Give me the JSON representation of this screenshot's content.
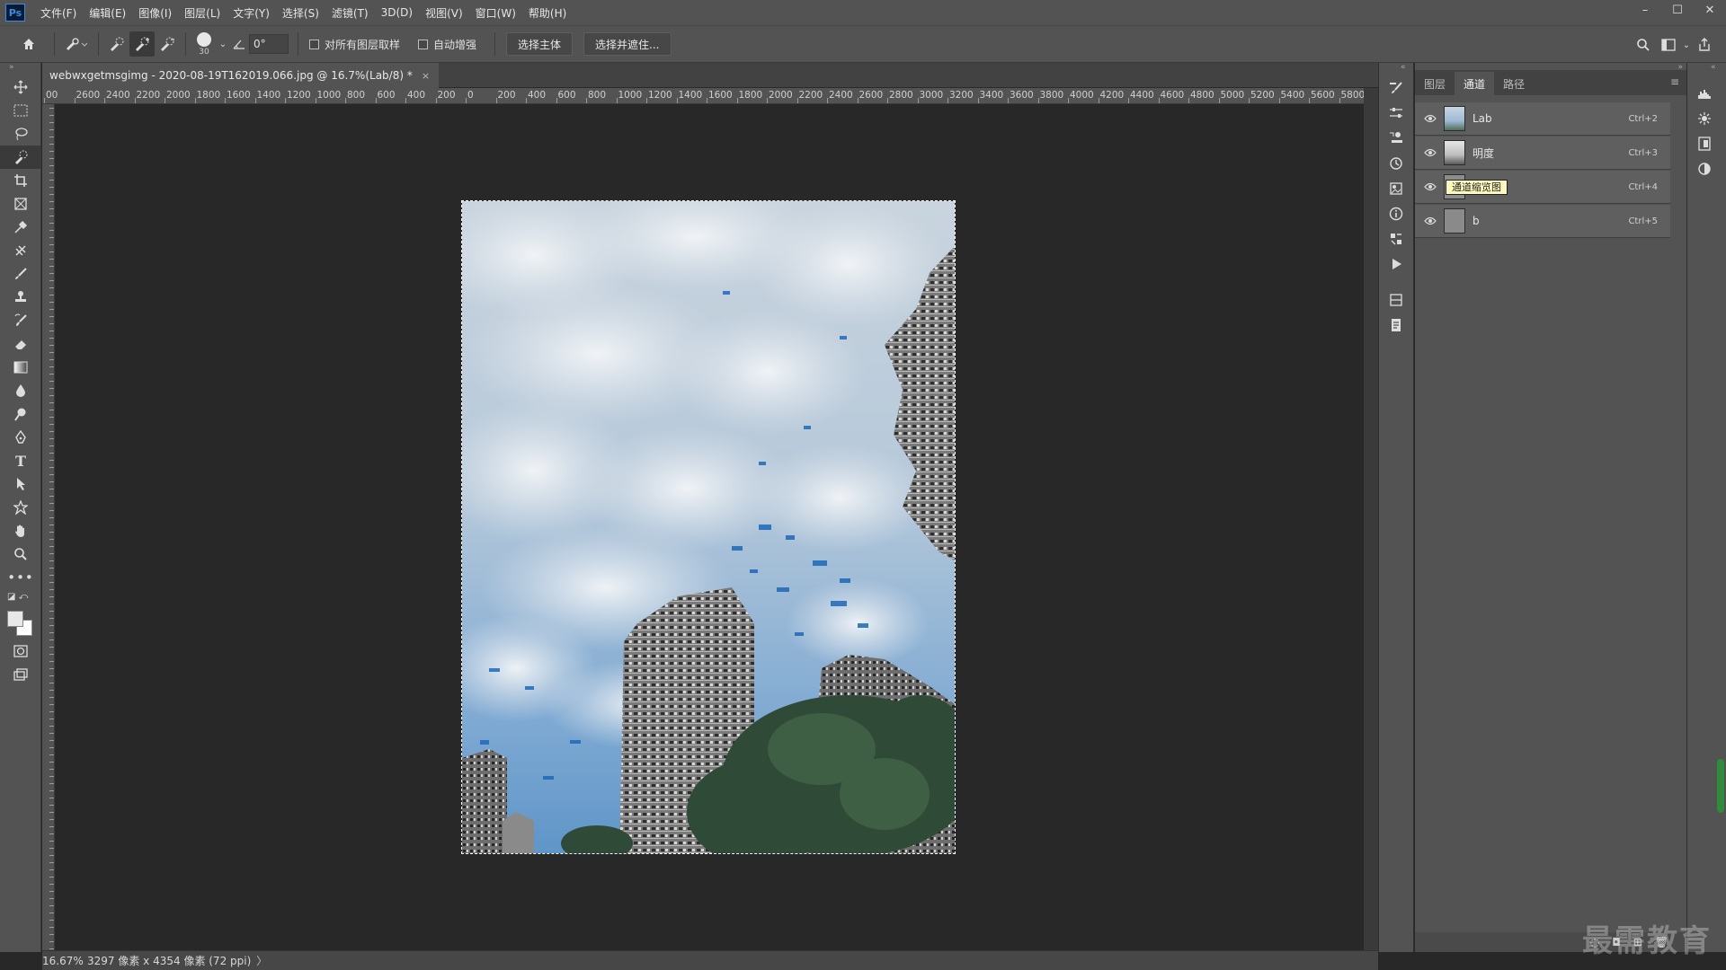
{
  "app": {
    "logo": "Ps",
    "menus": [
      "文件(F)",
      "编辑(E)",
      "图像(I)",
      "图层(L)",
      "文字(Y)",
      "选择(S)",
      "滤镜(T)",
      "3D(D)",
      "视图(V)",
      "窗口(W)",
      "帮助(H)"
    ],
    "window_controls": [
      "–",
      "☐",
      "✕"
    ]
  },
  "options": {
    "brush_size": "30",
    "angle_value": "0°",
    "sample_all_layers_label": "对所有图层取样",
    "auto_enhance_label": "自动增强",
    "select_subject_label": "选择主体",
    "select_mask_label": "选择并遮住..."
  },
  "document": {
    "tab_title": "webwxgetmsgimg - 2020-08-19T162019.066.jpg @ 16.7%(Lab/8) *",
    "tab_close": "×"
  },
  "ruler_top_labels": [
    "00",
    "2600",
    "2400",
    "2200",
    "2000",
    "1800",
    "1600",
    "1400",
    "1200",
    "1000",
    "800",
    "600",
    "400",
    "200",
    "0",
    "200",
    "400",
    "600",
    "800",
    "1000",
    "1200",
    "1400",
    "1600",
    "1800",
    "2000",
    "2200",
    "2400",
    "2600",
    "2800",
    "3000",
    "3200",
    "3400",
    "3600",
    "3800",
    "4000",
    "4200",
    "4400",
    "4600",
    "4800",
    "5000",
    "5200",
    "5400",
    "5600",
    "5800"
  ],
  "status": {
    "zoom": "16.67%",
    "size": "3297 像素 x 4354 像素 (72 ppi)",
    "arrow": "〉"
  },
  "panel": {
    "tabs": [
      "图层",
      "通道",
      "路径"
    ],
    "active_tab": "通道",
    "menu_icon": "≡",
    "channels": [
      {
        "name": "Lab",
        "shortcut": "Ctrl+2"
      },
      {
        "name": "明度",
        "shortcut": "Ctrl+3"
      },
      {
        "name": "通道缩览图",
        "shortcut": "Ctrl+4"
      },
      {
        "name": "b",
        "shortcut": "Ctrl+5"
      }
    ],
    "bottom_icons": [
      "◌",
      "◘",
      "⊞",
      "🗑"
    ]
  },
  "watermark": "最需教育",
  "colors": {
    "chrome": "#535353",
    "canvas_bg": "#282828",
    "accent_blue": "#2f8ee8",
    "rename_highlight": "#fffbc0"
  }
}
